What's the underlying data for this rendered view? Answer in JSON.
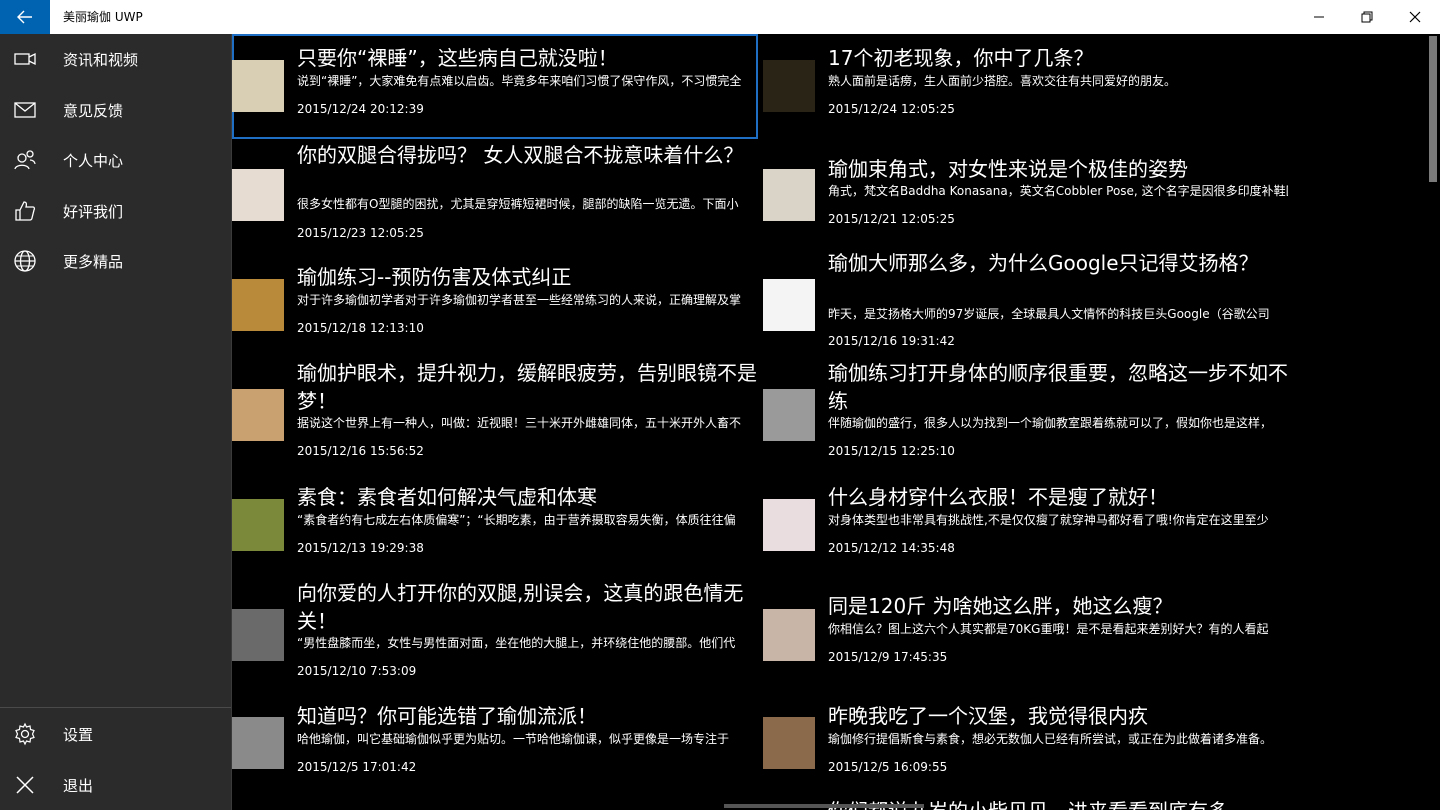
{
  "window": {
    "title": "美丽瑜伽 UWP",
    "minimize": "—",
    "maximize": "❐",
    "close": "✕"
  },
  "nav": {
    "items": [
      {
        "label": "资讯和视频",
        "icon": "video-camera-icon"
      },
      {
        "label": "意见反馈",
        "icon": "mail-icon"
      },
      {
        "label": "个人中心",
        "icon": "people-icon"
      },
      {
        "label": "好评我们",
        "icon": "thumbs-up-icon"
      },
      {
        "label": "更多精品",
        "icon": "globe-icon"
      }
    ],
    "bottom": [
      {
        "label": "设置",
        "icon": "gear-icon"
      },
      {
        "label": "退出",
        "icon": "close-icon"
      }
    ]
  },
  "articles": [
    {
      "title": "只要你“裸睡”，这些病自己就没啦！",
      "summary": "说到“裸睡”，大家难免有点难以启齿。毕竟多年来咱们习惯了保守作风，不习惯完全",
      "date": "2015/12/24 20:12:39",
      "thumb_color": "#d8cfb4"
    },
    {
      "title": "17个初老现象，你中了几条？",
      "summary": "熟人面前是话痨，生人面前少搭腔。喜欢交往有共同爱好的朋友。",
      "date": "2015/12/24 12:05:25",
      "thumb_color": "#2a2416"
    },
    {
      "title": "你的双腿合得拢吗？ 女人双腿合不拢意味着什么？",
      "summary": "很多女性都有O型腿的困扰，尤其是穿短裤短裙时候，腿部的缺陷一览无遗。下面小",
      "date": "2015/12/23 12:05:25",
      "thumb_color": "#e6dcd2"
    },
    {
      "title": "瑜伽束角式，对女性来说是个极佳的姿势",
      "summary": "角式，梵文名Baddha Konasana，英文名Cobbler Pose, 这个名字是因很多印度补鞋匠",
      "date": "2015/12/21 12:05:25",
      "thumb_color": "#d9d3c8"
    },
    {
      "title": "瑜伽练习--预防伤害及体式纠正",
      "summary": "对于许多瑜伽初学者对于许多瑜伽初学者甚至一些经常练习的人来说，正确理解及掌",
      "date": "2015/12/18 12:13:10",
      "thumb_color": "#b98a3a"
    },
    {
      "title": "瑜伽大师那么多，为什么Google只记得艾扬格？",
      "summary": "昨天，是艾扬格大师的97岁诞辰，全球最具人文情怀的科技巨头Google（谷歌公司",
      "date": "2015/12/16 19:31:42",
      "thumb_color": "#f4f4f4"
    },
    {
      "title": "瑜伽护眼术，提升视力，缓解眼疲劳，告别眼镜不是梦！",
      "summary": "据说这个世界上有一种人，叫做：近视眼！三十米开外雌雄同体，五十米开外人畜不",
      "date": "2015/12/16 15:56:52",
      "thumb_color": "#c9a070"
    },
    {
      "title": "瑜伽练习打开身体的顺序很重要，忽略这一步不如不练",
      "summary": "伴随瑜伽的盛行，很多人以为找到一个瑜伽教室跟着练就可以了，假如你也是这样，",
      "date": "2015/12/15 12:25:10",
      "thumb_color": "#9a9a9a"
    },
    {
      "title": "素食：素食者如何解决气虚和体寒",
      "summary": "“素食者约有七成左右体质偏寒”；“长期吃素，由于营养摄取容易失衡，体质往往偏",
      "date": "2015/12/13 19:29:38",
      "thumb_color": "#7a8a3a"
    },
    {
      "title": "什么身材穿什么衣服！不是瘦了就好！",
      "summary": "对身体类型也非常具有挑战性,不是仅仅瘦了就穿神马都好看了哦!你肯定在这里至少",
      "date": "2015/12/12 14:35:48",
      "thumb_color": "#e9dde0"
    },
    {
      "title": "向你爱的人打开你的双腿,别误会，这真的跟色情无关！",
      "summary": "“男性盘膝而坐，女性与男性面对面，坐在他的大腿上，并环绕住他的腰部。他们代",
      "date": "2015/12/10 7:53:09",
      "thumb_color": "#6a6a6a"
    },
    {
      "title": "同是120斤 为啥她这么胖，她这么瘦？",
      "summary": "你相信么？图上这六个人其实都是70KG重哦！是不是看起来差别好大？有的人看起",
      "date": "2015/12/9 17:45:35",
      "thumb_color": "#c8b5a8"
    },
    {
      "title": "知道吗？你可能选错了瑜伽流派！",
      "summary": "哈他瑜伽，叫它基础瑜伽似乎更为贴切。一节哈他瑜伽课，似乎更像是一场专注于",
      "date": "2015/12/5 17:01:42",
      "thumb_color": "#8a8a8a"
    },
    {
      "title": "昨晚我吃了一个汉堡，我觉得很内疚",
      "summary": "瑜伽修行提倡斯食与素食，想必无数伽人已经有所尝试，或正在为此做着诸多准备。",
      "date": "2015/12/5 16:09:55",
      "thumb_color": "#8a6a4a"
    },
    {
      "title": "你们都说九岁的小柴贝贝，进来看看到底有多",
      "summary": "",
      "date": "",
      "thumb_color": "#333333"
    }
  ]
}
